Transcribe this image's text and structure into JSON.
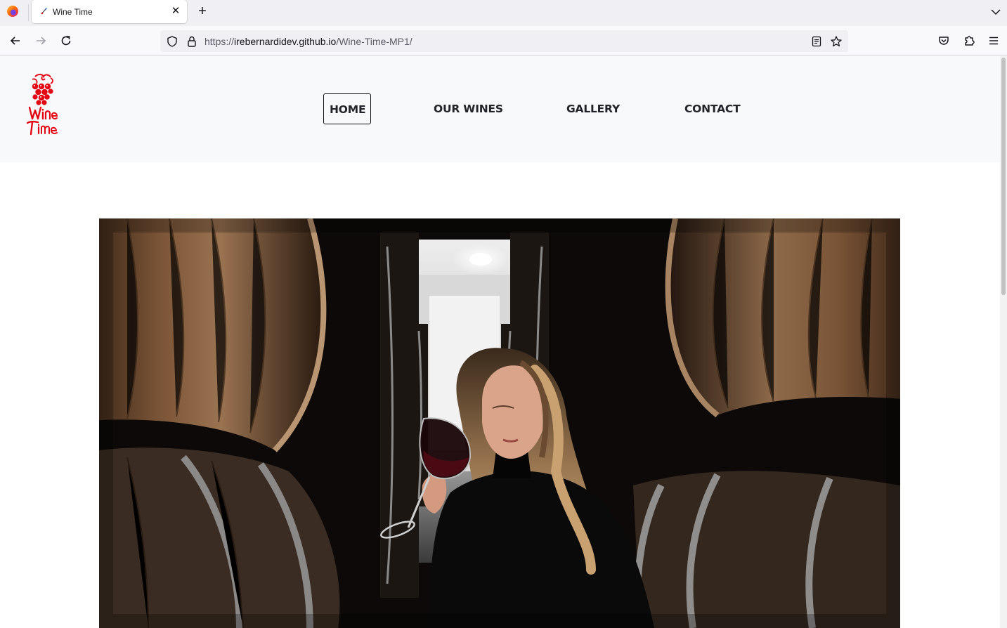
{
  "browser": {
    "tab_title": "Wine Time",
    "url_prefix": "https://",
    "url_host": "irebernardidev.github.io",
    "url_path": "/Wine-Time-MP1/"
  },
  "site": {
    "logo_text": "Wine Time",
    "nav": [
      {
        "label": "HOME",
        "active": true
      },
      {
        "label": "OUR WINES",
        "active": false
      },
      {
        "label": "GALLERY",
        "active": false
      },
      {
        "label": "CONTACT",
        "active": false
      }
    ],
    "accent_red": "#e30613"
  },
  "hero": {
    "image_description": "woman tasting red wine in barrel cellar"
  },
  "icons": [
    "firefox-logo",
    "tab-favicon",
    "close-icon",
    "plus-icon",
    "chevron-down-icon",
    "back-icon",
    "forward-icon",
    "reload-icon",
    "shield-icon",
    "lock-icon",
    "reader-view-icon",
    "bookmark-star-icon",
    "pocket-icon",
    "extensions-icon",
    "menu-icon"
  ]
}
